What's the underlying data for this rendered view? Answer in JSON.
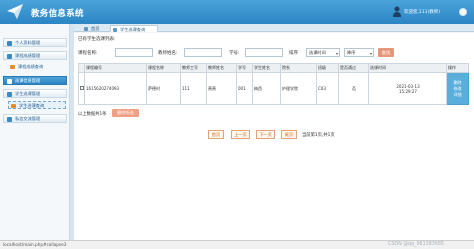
{
  "app": {
    "title": "教务信息系统"
  },
  "header": {
    "welcome": "欢迎您,111(教师)"
  },
  "sidebar": {
    "groups": [
      {
        "label": "个人资料管理"
      },
      {
        "label": "课程成绩管理",
        "items": [
          {
            "label": "课程成绩查询"
          }
        ]
      },
      {
        "label": "选课信息管理"
      },
      {
        "label": "学生选课管理",
        "items": [
          {
            "label": "学生选课查询"
          }
        ]
      },
      {
        "label": "私信交流管理"
      }
    ]
  },
  "tabs": [
    {
      "label": "首页"
    },
    {
      "label": "学生选课查询"
    }
  ],
  "breadcrumb": "已有学生选课列表:",
  "search": {
    "course_name_label": "课程名称:",
    "teacher_name_label": "教师姓名:",
    "student_no_label": "学号:",
    "sort_label": "排序",
    "sort_value": "选课时间",
    "order_value": "降序",
    "button_label": "查找"
  },
  "table": {
    "columns": [
      "",
      "课程编号",
      "课程名称",
      "教师工号",
      "教师姓名",
      "学号",
      "学生姓名",
      "院系",
      "班级",
      "是否通过",
      "选课时间",
      "操作"
    ],
    "rows": [
      {
        "checked": false,
        "course_no": "1615620274093",
        "course_name": "萨德时",
        "teacher_no": "111",
        "teacher_name": "萧萧",
        "student_no": "001",
        "student_name": "梅西",
        "department": "护理学院",
        "class": "C03",
        "passed": "否",
        "time_date": "2021-03-13",
        "time_clock": "15:29:27",
        "actions": [
          "删除",
          "修改",
          "详细"
        ]
      }
    ]
  },
  "footer": {
    "total_text": "以上数据共1条",
    "delete_button": "删除所选"
  },
  "pager": {
    "buttons": [
      "首页",
      "上一页",
      "下一页",
      "尾页"
    ],
    "info": "当前第1页,共1页"
  },
  "statusbar": {
    "url": "localhost/main.php#collapse3",
    "watermark": "CSDN @qq_961383685"
  },
  "colors": {
    "header": "#2b85c4",
    "accent": "#e8967a",
    "action_column": "#5aaedc"
  }
}
